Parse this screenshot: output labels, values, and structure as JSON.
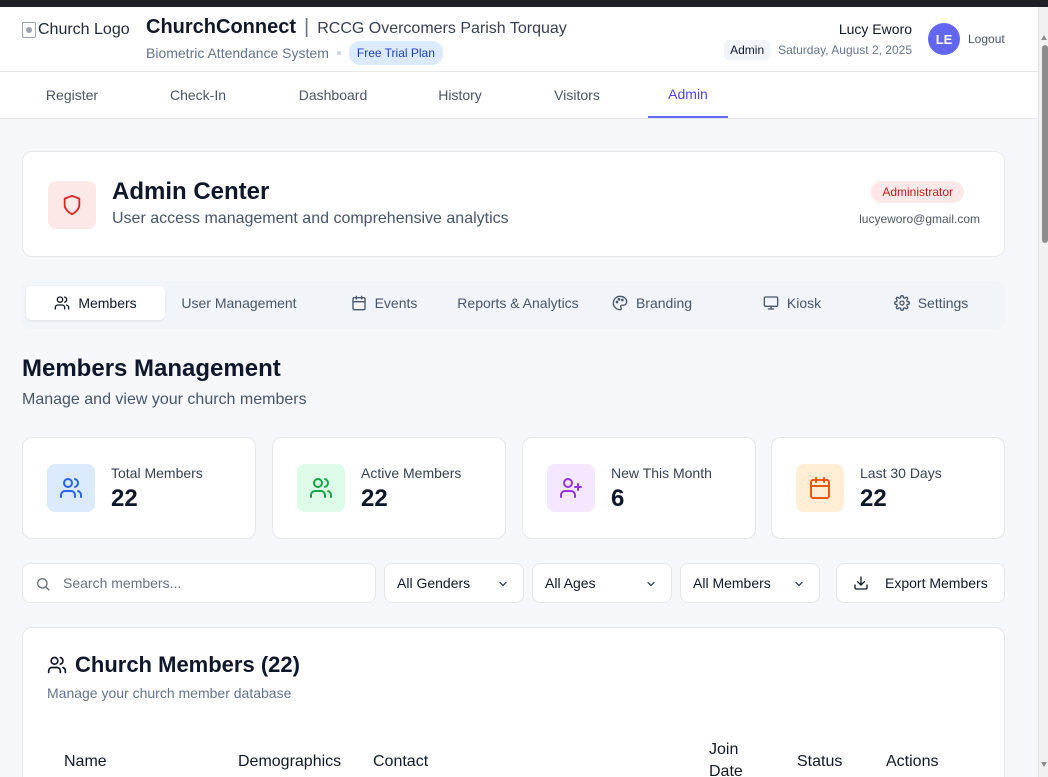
{
  "header": {
    "logo_alt": "Church Logo",
    "app_name": "ChurchConnect",
    "separator": "|",
    "parish": "RCCG Overcomers Parish Torquay",
    "system_name": "Biometric Attendance System",
    "plan_badge": "Free Trial Plan",
    "user_name": "Lucy Eworo",
    "user_role": "Admin",
    "date": "Saturday, August 2, 2025",
    "avatar_initials": "LE",
    "logout_label": "Logout"
  },
  "nav": {
    "tabs": [
      {
        "label": "Register",
        "active": false
      },
      {
        "label": "Check-In",
        "active": false
      },
      {
        "label": "Dashboard",
        "active": false
      },
      {
        "label": "History",
        "active": false
      },
      {
        "label": "Visitors",
        "active": false
      },
      {
        "label": "Admin",
        "active": true
      }
    ]
  },
  "admin_center": {
    "title": "Admin Center",
    "subtitle": "User access management and comprehensive analytics",
    "role_badge": "Administrator",
    "email": "lucyeworo@gmail.com"
  },
  "admin_tabs": [
    {
      "label": "Members",
      "icon": "users-icon",
      "active": true
    },
    {
      "label": "User Management",
      "icon": "",
      "active": false
    },
    {
      "label": "Events",
      "icon": "calendar-icon",
      "active": false
    },
    {
      "label": "Reports & Analytics",
      "icon": "",
      "active": false
    },
    {
      "label": "Branding",
      "icon": "palette-icon",
      "active": false
    },
    {
      "label": "Kiosk",
      "icon": "monitor-icon",
      "active": false
    },
    {
      "label": "Settings",
      "icon": "gear-icon",
      "active": false
    }
  ],
  "members_management": {
    "title": "Members Management",
    "subtitle": "Manage and view your church members"
  },
  "stats": [
    {
      "label": "Total Members",
      "value": "22",
      "icon": "users-icon",
      "color": "#2563eb",
      "bg": "#dbeafe"
    },
    {
      "label": "Active Members",
      "value": "22",
      "icon": "users-icon",
      "color": "#16a34a",
      "bg": "#dcfce7"
    },
    {
      "label": "New This Month",
      "value": "6",
      "icon": "user-plus-icon",
      "color": "#9333ea",
      "bg": "#f3e8ff"
    },
    {
      "label": "Last 30 Days",
      "value": "22",
      "icon": "calendar-icon",
      "color": "#ea580c",
      "bg": "#ffedd5"
    }
  ],
  "filters": {
    "search_placeholder": "Search members...",
    "gender": "All Genders",
    "age": "All Ages",
    "member_type": "All Members",
    "export_label": "Export Members"
  },
  "church_members": {
    "title": "Church Members (22)",
    "subtitle": "Manage your church member database",
    "columns": [
      "Name",
      "Demographics",
      "Contact",
      "Join",
      "Date",
      "Status",
      "Actions"
    ]
  },
  "colors": {
    "accent": "#6366f1",
    "admin_red": "#dc2626"
  }
}
